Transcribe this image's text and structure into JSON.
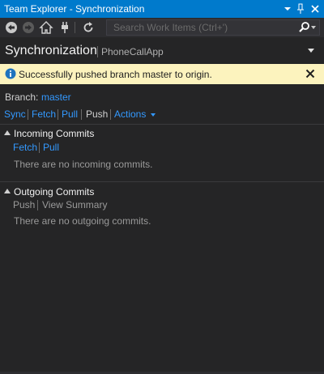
{
  "window": {
    "title": "Team Explorer - Synchronization",
    "accent": "#007acc"
  },
  "toolbar": {
    "search_placeholder": "Search Work Items (Ctrl+')",
    "icons": [
      "back-icon",
      "forward-icon",
      "home-icon",
      "connect-icon",
      "refresh-icon",
      "search-icon"
    ]
  },
  "header": {
    "title": "Synchronization",
    "subtitle": "PhoneCallApp"
  },
  "notification": {
    "message": "Successfully pushed branch master to origin.",
    "background": "#fcf3be"
  },
  "branch": {
    "label": "Branch:",
    "value": "master"
  },
  "actions": {
    "sync": "Sync",
    "fetch": "Fetch",
    "pull": "Pull",
    "push": "Push",
    "more": "Actions"
  },
  "incoming": {
    "title": "Incoming Commits",
    "fetch": "Fetch",
    "pull": "Pull",
    "empty": "There are no incoming commits."
  },
  "outgoing": {
    "title": "Outgoing Commits",
    "push": "Push",
    "view_summary": "View Summary",
    "empty": "There are no outgoing commits."
  }
}
